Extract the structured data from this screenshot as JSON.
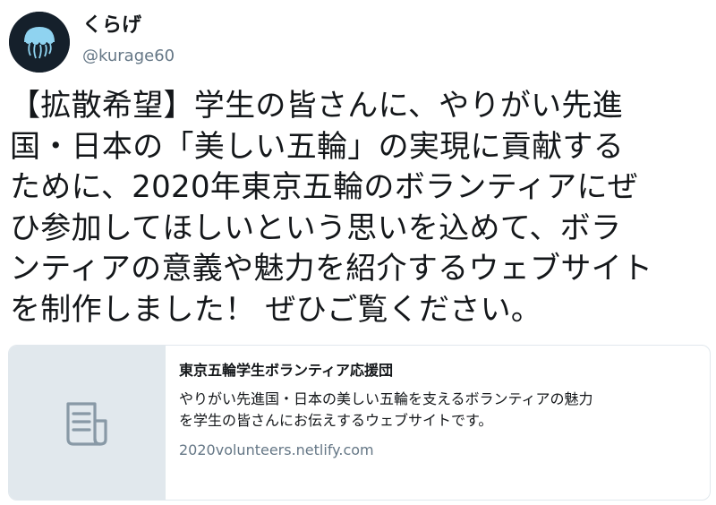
{
  "author": {
    "display_name": "くらげ",
    "handle": "@kurage60",
    "avatar_icon": "jellyfish-icon"
  },
  "tweet": {
    "text_lines": [
      "【拡散希望】学生の皆さんに、やりがい先進",
      "国・日本の「美しい五輪」の実現に貢献する",
      "ために、2020年東京五輪のボランティアにぜ",
      "ひ参加してほしいという思いを込めて、ボラ",
      "ンティアの意義や魅力を紹介するウェブサイト",
      "を制作しました！ ぜひご覧ください。"
    ]
  },
  "card": {
    "thumbnail_icon": "document-icon",
    "title": "東京五輪学生ボランティア応援団",
    "description_lines": [
      "やりがい先進国・日本の美しい五輪を支えるボランティアの魅力",
      "を学生の皆さんにお伝えするウェブサイトです。"
    ],
    "url": "2020volunteers.netlify.com"
  },
  "colors": {
    "text": "#14171a",
    "secondary": "#657786",
    "card_border": "#e1e8ed",
    "avatar_bg": "#15202b",
    "jellyfish": "#8fd3f0"
  }
}
